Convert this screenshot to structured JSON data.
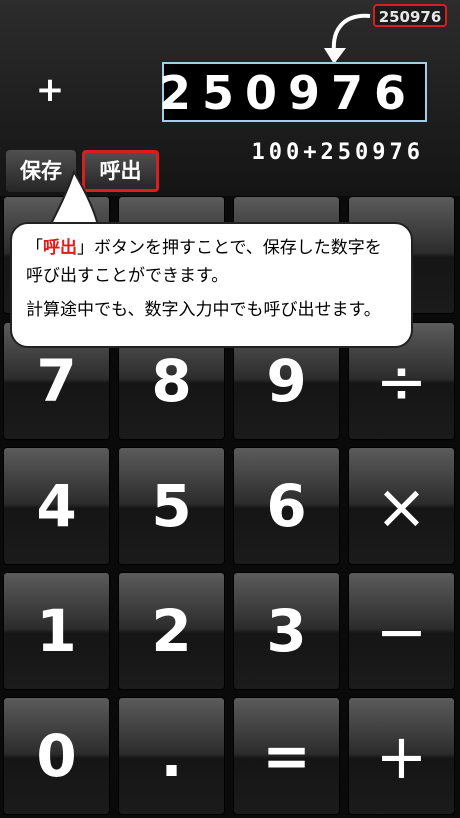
{
  "display": {
    "saved_value": "250976",
    "operator": "+",
    "result": "250976",
    "expression": "100+250976"
  },
  "memory": {
    "save_label": "保存",
    "recall_label": "呼出"
  },
  "callout": {
    "open_bracket": "「",
    "highlight": "呼出",
    "line1_rest": "」ボタンを押すことで、保存した数字を",
    "line2": "呼び出すことができます。",
    "line3": "計算途中でも、数字入力中でも呼び出せます。"
  },
  "keys": [
    {
      "label": "",
      "name": "key-hidden-1"
    },
    {
      "label": "",
      "name": "key-hidden-2"
    },
    {
      "label": "",
      "name": "key-hidden-3"
    },
    {
      "label": "",
      "name": "key-hidden-4"
    },
    {
      "label": "7",
      "name": "key-7"
    },
    {
      "label": "8",
      "name": "key-8"
    },
    {
      "label": "9",
      "name": "key-9"
    },
    {
      "label": "÷",
      "name": "key-divide"
    },
    {
      "label": "4",
      "name": "key-4"
    },
    {
      "label": "5",
      "name": "key-5"
    },
    {
      "label": "6",
      "name": "key-6"
    },
    {
      "label": "×",
      "name": "key-multiply"
    },
    {
      "label": "1",
      "name": "key-1"
    },
    {
      "label": "2",
      "name": "key-2"
    },
    {
      "label": "3",
      "name": "key-3"
    },
    {
      "label": "−",
      "name": "key-subtract"
    },
    {
      "label": "0",
      "name": "key-0"
    },
    {
      "label": ".",
      "name": "key-decimal"
    },
    {
      "label": "=",
      "name": "key-equals"
    },
    {
      "label": "+",
      "name": "key-add"
    }
  ],
  "colors": {
    "accent": "#d81f1f",
    "result_border": "#9fd0ea"
  }
}
